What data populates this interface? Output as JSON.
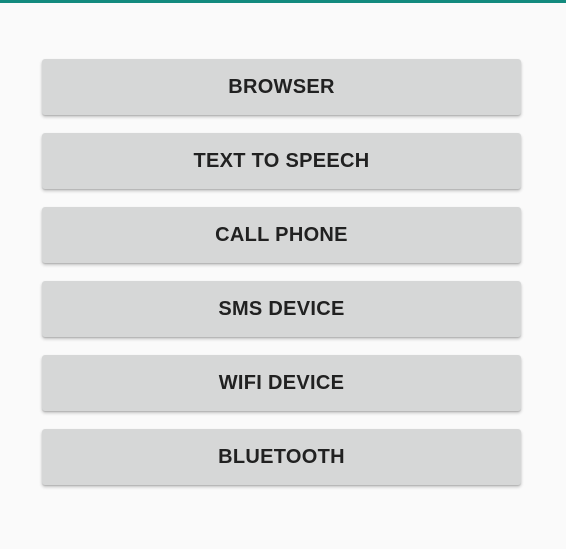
{
  "theme": {
    "accent_color": "#138a7e",
    "background_color": "#fafafa",
    "button_color": "#d6d7d7",
    "button_text_color": "#212121"
  },
  "buttons": [
    {
      "label": "BROWSER"
    },
    {
      "label": "TEXT TO SPEECH"
    },
    {
      "label": "CALL PHONE"
    },
    {
      "label": "SMS DEVICE"
    },
    {
      "label": "WIFI DEVICE"
    },
    {
      "label": "BLUETOOTH"
    }
  ]
}
